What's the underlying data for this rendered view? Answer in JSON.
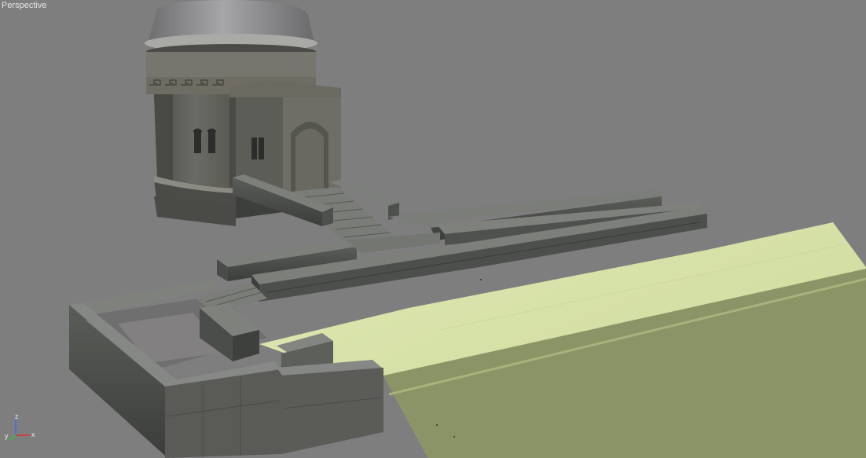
{
  "viewport": {
    "label": "Perspective"
  },
  "axis_gizmo": {
    "z_label": "z",
    "y_label": "y",
    "x_label": "x",
    "z_color": "#3a6cff",
    "y_color": "#2fbf2f",
    "x_color": "#e03030"
  },
  "colors": {
    "background": "#7e7e7e",
    "terrain_light": "#d6e2a4",
    "terrain_dark": "#8a9466",
    "stone_top": "#6f6f6f",
    "stone_side": "#4a4d4a",
    "dome": "#9a9a9c"
  }
}
